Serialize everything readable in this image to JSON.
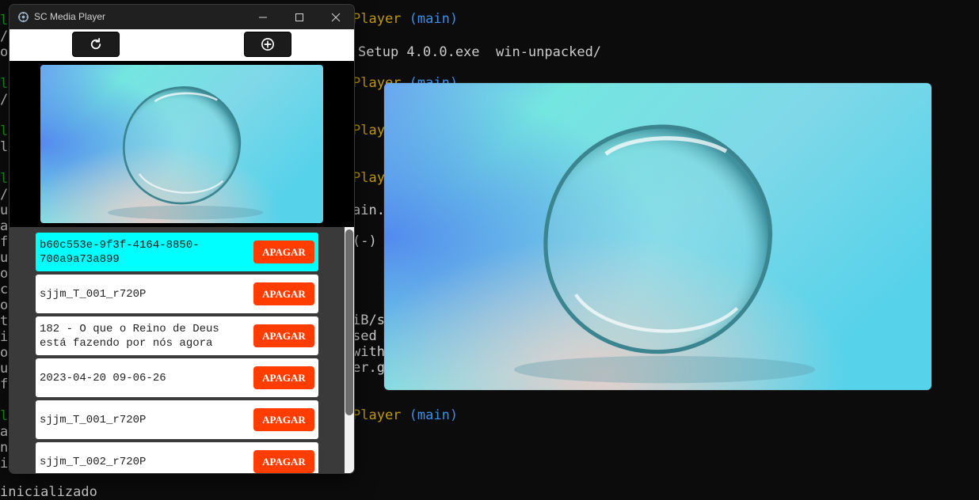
{
  "terminal": {
    "prompt_app": "Player",
    "branch": "(main)",
    "files": "Setup 4.0.0.exe  win-unpacked/",
    "fragments": [
      "ain.m",
      "(-)",
      "iB/s",
      "sed (",
      "with",
      "er.gi"
    ],
    "left_edge": [
      "lo",
      "/d",
      "on",
      "lo",
      "/d",
      "lo",
      "l",
      "lo",
      "/g",
      "ui",
      "an",
      "fi",
      "ue",
      "ot",
      "ca",
      "or",
      "ti",
      "il",
      "ot",
      "ut",
      "f1",
      "lo",
      "ar",
      "n",
      "ie"
    ],
    "bottom_text": "inicializado"
  },
  "window": {
    "title": "SC Media Player"
  },
  "toolbar": {
    "refresh_icon": "refresh-icon",
    "add_icon": "add-circle-icon"
  },
  "list": {
    "delete_label": "APAGAR",
    "items": [
      {
        "text": "b60c553e-9f3f-4164-8850-700a9a73a899",
        "active": true
      },
      {
        "text": "sjjm_T_001_r720P",
        "active": false
      },
      {
        "text": "182 - O que o Reino de Deus está fazendo por nós agora",
        "active": false
      },
      {
        "text": "2023-04-20 09-06-26",
        "active": false
      },
      {
        "text": "sjjm_T_001_r720P",
        "active": false
      },
      {
        "text": "sjjm_T_002_r720P",
        "active": false
      }
    ]
  },
  "colors": {
    "active_item": "#00ffff",
    "delete_button": "#ff3d00",
    "terminal_yellow": "#c19c00",
    "terminal_blue": "#3b8eea"
  }
}
